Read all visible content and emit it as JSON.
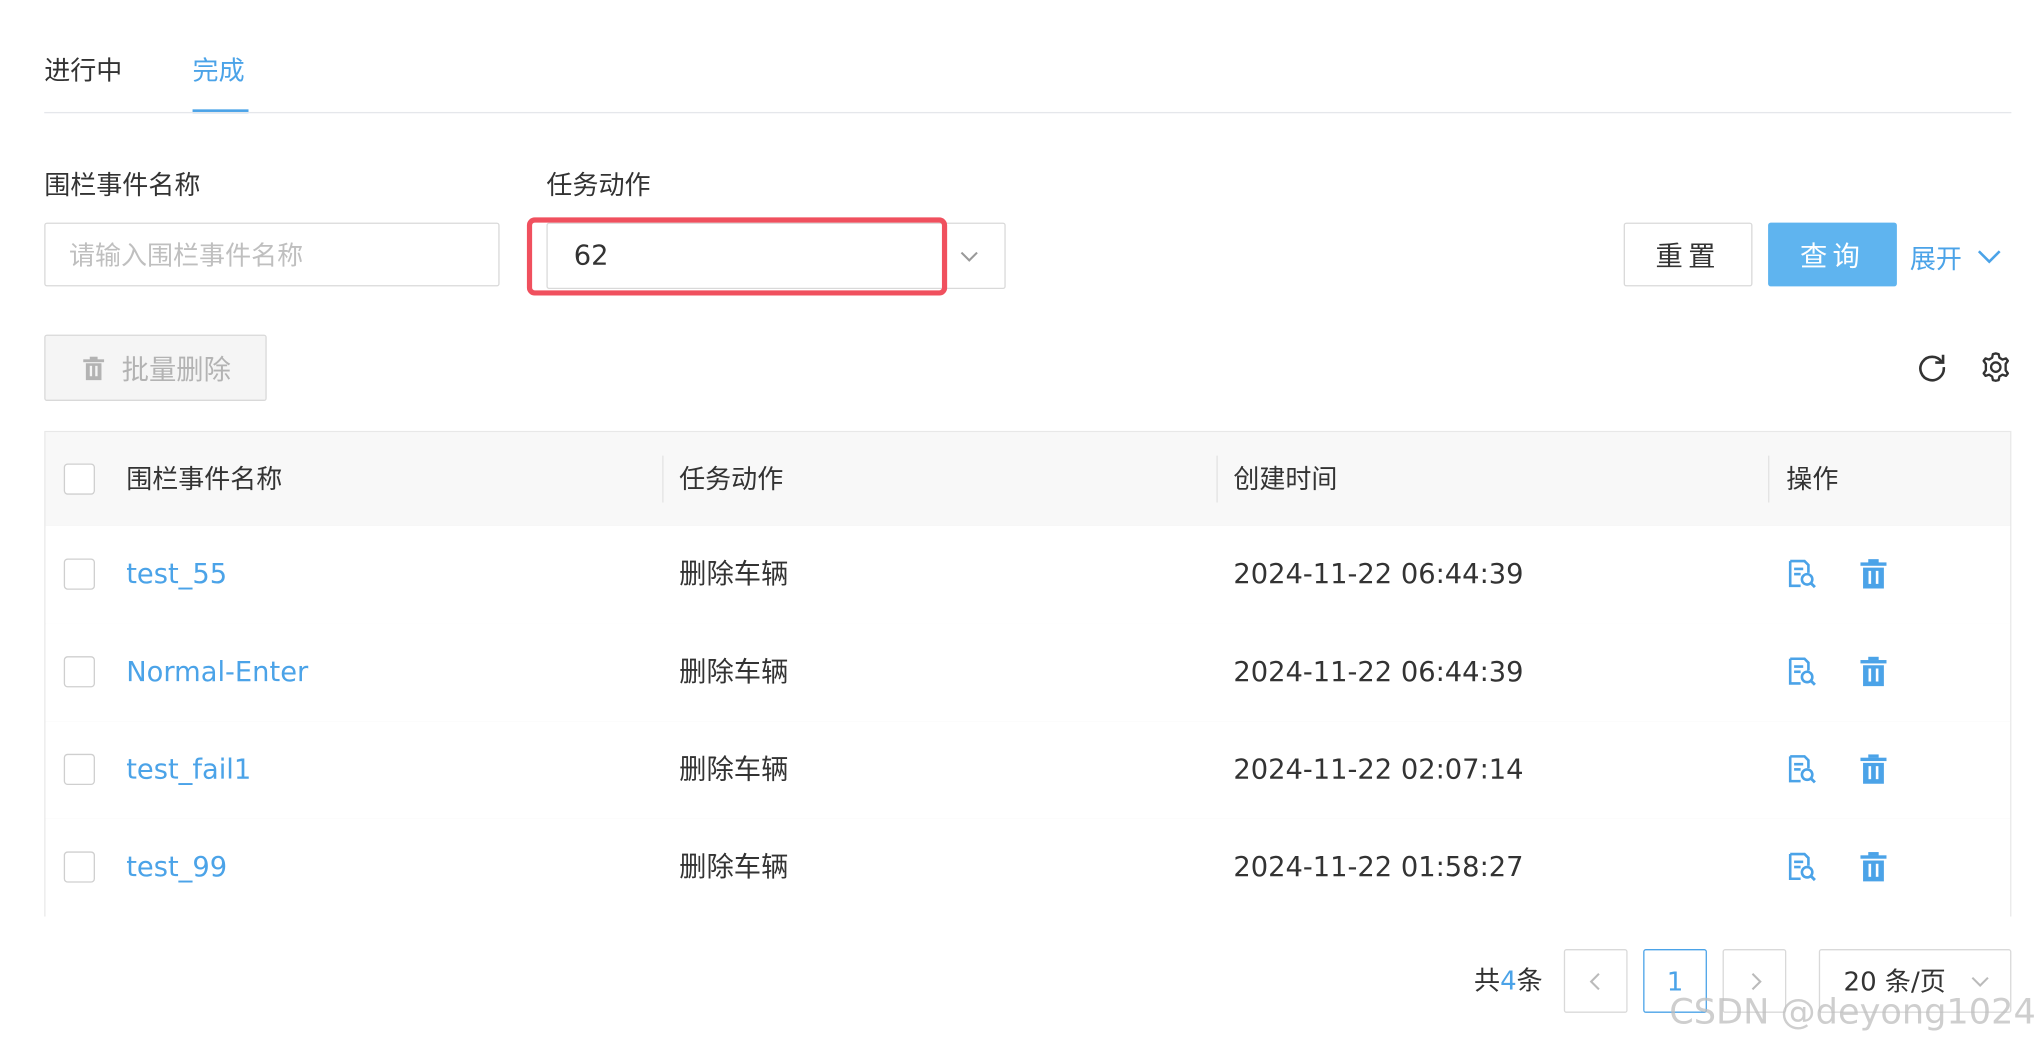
{
  "tabs": [
    {
      "label": "进行中",
      "active": false
    },
    {
      "label": "完成",
      "active": true
    }
  ],
  "filters": {
    "fence_event_name": {
      "label": "围栏事件名称",
      "value": "",
      "placeholder": "请输入围栏事件名称"
    },
    "task_action": {
      "label": "任务动作",
      "value": "62"
    }
  },
  "buttons": {
    "reset": "重置",
    "query": "查询",
    "expand": "展开",
    "batch_delete": "批量删除"
  },
  "table": {
    "columns": [
      "围栏事件名称",
      "任务动作",
      "创建时间",
      "操作"
    ],
    "rows": [
      {
        "name": "test_55",
        "action": "删除车辆",
        "created": "2024-11-22 06:44:39"
      },
      {
        "name": "Normal-Enter",
        "action": "删除车辆",
        "created": "2024-11-22 06:44:39"
      },
      {
        "name": "test_fail1",
        "action": "删除车辆",
        "created": "2024-11-22 02:07:14"
      },
      {
        "name": "test_99",
        "action": "删除车辆",
        "created": "2024-11-22 01:58:27"
      }
    ]
  },
  "pagination": {
    "total_prefix": "共",
    "total": "4",
    "total_suffix": "条",
    "current_page": "1",
    "page_size": "20 条/页"
  },
  "watermark": "CSDN @deyong1024",
  "colors": {
    "accent": "#4ba3e8",
    "primary_button": "#5fb4ef",
    "highlight": "#f0505e"
  },
  "icons": {
    "select_arrow": "chevron-down-icon",
    "batch_delete": "trash-icon",
    "refresh": "refresh-icon",
    "settings": "gear-icon",
    "row_view": "document-search-icon",
    "row_delete": "trash-icon",
    "prev": "chevron-left-icon",
    "next": "chevron-right-icon"
  }
}
